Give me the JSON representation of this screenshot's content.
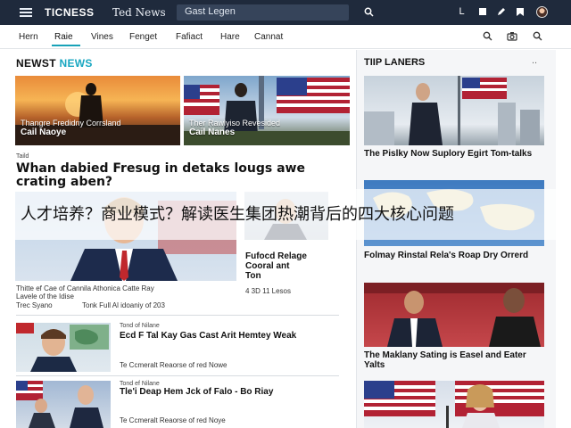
{
  "topbar": {
    "brand": "TICNESS",
    "brand_secondary": "Ted News",
    "search_text": "Gast Legen",
    "icons": [
      "search-icon",
      "user-icon",
      "save-icon",
      "edit-icon",
      "bookmark-icon",
      "avatar"
    ],
    "user_label": "L"
  },
  "nav": {
    "items": [
      "Hern",
      "Raie",
      "Vines",
      "Fenget",
      "Fafiact",
      "Hare",
      "Cannat"
    ],
    "active_index": 1,
    "tools": [
      "search-icon",
      "camera-icon",
      "search-icon-alt"
    ]
  },
  "left": {
    "section_title": "NEWST",
    "section_accent": "NEWS",
    "card1": {
      "caption_line1": "Thangre Fredidny Corrsland",
      "caption_line2": "Cail Naoye"
    },
    "card2": {
      "caption_line1": "Ther Rawlyiso Revesided",
      "caption_line2": "Cail Nanes"
    },
    "headline_label": "Taild",
    "headline": "Whan dabied Fresug in detaks lougs awe crating aben?",
    "feature": {
      "meta_line1": "Thitte ef Cae of Cannila Athonica Catte Ray",
      "meta_line2": "Lavele of the Idise",
      "meta_line3": "Trec Syano",
      "meta_line4": "Tonk Full Al idoaniy of 203",
      "side_title_1": "Fufocd Relage",
      "side_title_2": "Cooral ant",
      "side_title_3": "Ton",
      "side_meta": "4 3D 11 Lesos"
    },
    "list": [
      {
        "label": "Tond of Nilane",
        "title": "Ecd F Tal Kay Gas Cast Arit Hemtey Weak",
        "meta": "Te Ccmeralt Reaorse of red Nowe"
      },
      {
        "label": "Tond ef Nilane",
        "title": "Tle'i Deap Hem Jck of Falo - Bo Riay",
        "meta": "Te Ccmeralt Reaorse of red Noye"
      }
    ]
  },
  "sidebar": {
    "title": "TIIP LANERS",
    "more": "..",
    "items": [
      {
        "title": "The Pislky Now Suplory Egirt Tom-talks"
      },
      {
        "title": "Folmay Rinstal Rela's Roap Dry Orrerd"
      },
      {
        "title": "The Maklany Sating is Easel and Eater Yalts"
      }
    ]
  },
  "banner": {
    "text": "人才培养？商业模式？解读医生集团热潮背后的四大核心问题"
  }
}
